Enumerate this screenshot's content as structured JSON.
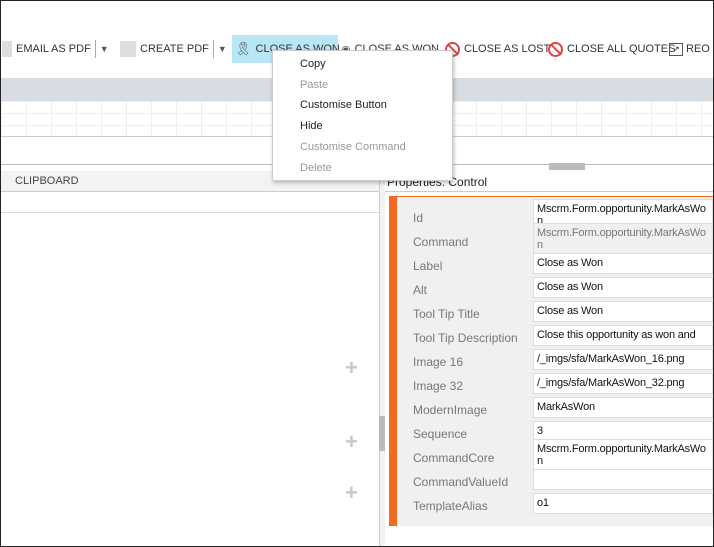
{
  "toolbar": {
    "items": [
      {
        "label": "EMAIL AS PDF",
        "icon": "blank-icon",
        "dropdown": true
      },
      {
        "label": "CREATE PDF",
        "icon": "blank-icon",
        "dropdown": true
      },
      {
        "label": "CLOSE AS WON",
        "icon": "ribbon-award-icon",
        "selected": true
      },
      {
        "label": "CLOSE AS WON",
        "icon": "award-edit-icon"
      },
      {
        "label": "CLOSE AS LOST",
        "icon": "ban-icon"
      },
      {
        "label": "CLOSE ALL QUOTES",
        "icon": "ban-icon"
      },
      {
        "label": "REO",
        "icon": "reopen-icon"
      }
    ],
    "selected_color": "#b8e6f5"
  },
  "context_menu": {
    "items": [
      {
        "label": "Copy",
        "enabled": true
      },
      {
        "label": "Paste",
        "enabled": false
      },
      {
        "label": "Customise Button",
        "enabled": true
      },
      {
        "label": "Hide",
        "enabled": true,
        "highlighted": true
      },
      {
        "label": "Customise Command",
        "enabled": false
      },
      {
        "label": "Delete",
        "enabled": false
      }
    ],
    "highlight_color": "#ffe800"
  },
  "left_panel": {
    "title": "CLIPBOARD"
  },
  "properties": {
    "title": "Properties: Control",
    "accent": "#f26b21",
    "fields": [
      {
        "label": "Id",
        "value": "Mscrm.Form.opportunity.MarkAsWon"
      },
      {
        "label": "Command",
        "value": "Mscrm.Form.opportunity.MarkAsWon",
        "readonly": true
      },
      {
        "label": "Label",
        "value": "Close as Won"
      },
      {
        "label": "Alt",
        "value": "Close as Won"
      },
      {
        "label": "Tool Tip Title",
        "value": "Close as Won"
      },
      {
        "label": "Tool Tip Description",
        "value": "Close this opportunity as won and"
      },
      {
        "label": "Image 16",
        "value": "/_imgs/sfa/MarkAsWon_16.png"
      },
      {
        "label": "Image 32",
        "value": "/_imgs/sfa/MarkAsWon_32.png"
      },
      {
        "label": "ModernImage",
        "value": "MarkAsWon"
      },
      {
        "label": "Sequence",
        "value": "3"
      },
      {
        "label": "CommandCore",
        "value": "Mscrm.Form.opportunity.MarkAsWon"
      },
      {
        "label": "CommandValueId",
        "value": ""
      },
      {
        "label": "TemplateAlias",
        "value": "o1"
      }
    ]
  }
}
